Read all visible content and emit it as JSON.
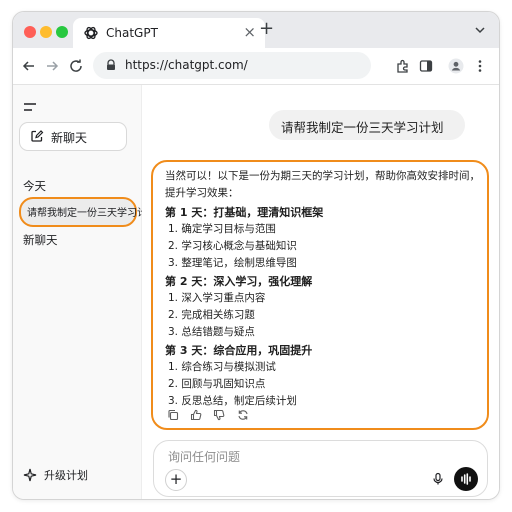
{
  "browser": {
    "tab_title": "ChatGPT",
    "tab_close": "×",
    "new_tab": "+",
    "url": "https://chatgpt.com/"
  },
  "sidebar": {
    "new_chat_label": "新聊天",
    "section_label": "今天",
    "items": [
      {
        "label": "请帮我制定一份三天学习计划",
        "active": true
      },
      {
        "label": "新聊天",
        "active": false
      }
    ],
    "upgrade_label": "升级计划"
  },
  "conversation": {
    "user_message": "请帮我制定一份三天学习计划",
    "assistant_intro": "当然可以！以下是一份为期三天的学习计划，帮助你高效安排时间，提升学习效果：",
    "days": [
      {
        "heading": "第 1 天：打基础，理清知识框架",
        "items": [
          "1.  确定学习目标与范围",
          "2.  学习核心概念与基础知识",
          "3.  整理笔记，绘制思维导图"
        ]
      },
      {
        "heading": "第 2 天：深入学习，强化理解",
        "items": [
          "1.  深入学习重点内容",
          "2.  完成相关练习题",
          "3.  总结错题与疑点"
        ]
      },
      {
        "heading": "第 3 天：综合应用，巩固提升",
        "items": [
          "1.  综合练习与模拟测试",
          "2.  回顾与巩固知识点",
          "3.  反思总结，制定后续计划"
        ]
      }
    ]
  },
  "composer": {
    "placeholder": "询问任何问题",
    "plus": "+"
  },
  "colors": {
    "highlight": "#f08c1b",
    "sidebar_bg": "#f9f9f9",
    "bubble_bg": "#f1f1f1"
  }
}
